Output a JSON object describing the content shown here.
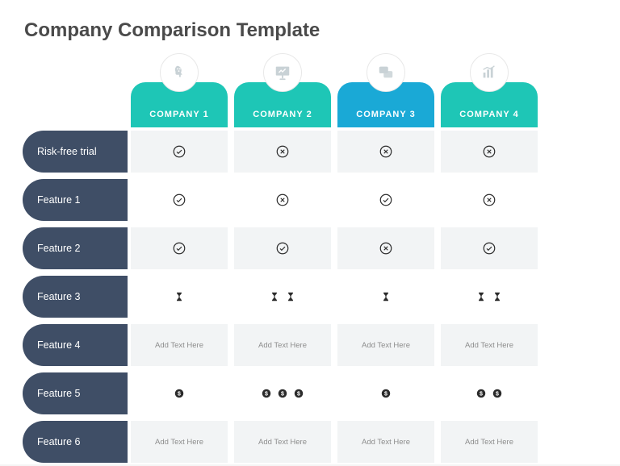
{
  "title": "Company Comparison Template",
  "colors": {
    "teal": "#1ec6b6",
    "blue": "#1aa9d6",
    "slate": "#3f4e66",
    "iconGrey": "#c9d2d6",
    "mark": "#2b2b2b"
  },
  "columns": [
    {
      "label": "COMPANY 1",
      "color": "teal",
      "icon": "head-gear"
    },
    {
      "label": "COMPANY 2",
      "color": "teal",
      "icon": "presentation"
    },
    {
      "label": "COMPANY 3",
      "color": "blue",
      "icon": "chat"
    },
    {
      "label": "COMPANY 4",
      "color": "teal",
      "icon": "bar-chart"
    }
  ],
  "rows": [
    {
      "label": "Risk-free trial",
      "alt": true,
      "cells": [
        {
          "type": "check"
        },
        {
          "type": "cross"
        },
        {
          "type": "cross"
        },
        {
          "type": "cross"
        }
      ]
    },
    {
      "label": "Feature 1",
      "alt": false,
      "cells": [
        {
          "type": "check"
        },
        {
          "type": "cross"
        },
        {
          "type": "check"
        },
        {
          "type": "cross"
        }
      ]
    },
    {
      "label": "Feature 2",
      "alt": true,
      "cells": [
        {
          "type": "check"
        },
        {
          "type": "check"
        },
        {
          "type": "cross"
        },
        {
          "type": "check"
        }
      ]
    },
    {
      "label": "Feature 3",
      "alt": false,
      "cells": [
        {
          "type": "hourglass",
          "count": 1
        },
        {
          "type": "hourglass",
          "count": 2
        },
        {
          "type": "hourglass",
          "count": 1
        },
        {
          "type": "hourglass",
          "count": 2
        }
      ]
    },
    {
      "label": "Feature 4",
      "alt": true,
      "cells": [
        {
          "type": "text",
          "value": "Add Text Here"
        },
        {
          "type": "text",
          "value": "Add Text Here"
        },
        {
          "type": "text",
          "value": "Add Text Here"
        },
        {
          "type": "text",
          "value": "Add Text Here"
        }
      ]
    },
    {
      "label": "Feature 5",
      "alt": false,
      "cells": [
        {
          "type": "dollar",
          "count": 1
        },
        {
          "type": "dollar",
          "count": 3
        },
        {
          "type": "dollar",
          "count": 1
        },
        {
          "type": "dollar",
          "count": 2
        }
      ]
    },
    {
      "label": "Feature 6",
      "alt": true,
      "cells": [
        {
          "type": "text",
          "value": "Add Text Here"
        },
        {
          "type": "text",
          "value": "Add Text Here"
        },
        {
          "type": "text",
          "value": "Add Text Here"
        },
        {
          "type": "text",
          "value": "Add Text Here"
        }
      ]
    }
  ]
}
